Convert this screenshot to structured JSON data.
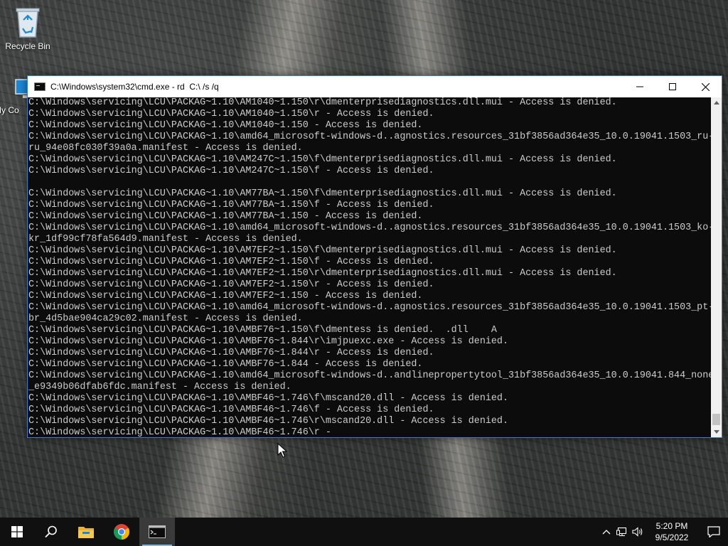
{
  "desktop": {
    "icons": [
      {
        "label": "Recycle Bin",
        "icon": "recycle-bin-icon"
      },
      {
        "label": "My Co",
        "icon": "computer-icon"
      }
    ]
  },
  "cmd_window": {
    "title": "C:\\Windows\\system32\\cmd.exe - rd  C:\\ /s /q",
    "controls": {
      "minimize": "minimize-icon",
      "maximize": "maximize-icon",
      "close": "close-icon"
    },
    "lines": [
      "C:\\Windows\\servicing\\LCU\\PACKAG~1.10\\AM1040~1.150\\r\\dmenterprisediagnostics.dll.mui - Access is denied.",
      "C:\\Windows\\servicing\\LCU\\PACKAG~1.10\\AM1040~1.150\\r - Access is denied.",
      "C:\\Windows\\servicing\\LCU\\PACKAG~1.10\\AM1040~1.150 - Access is denied.",
      "C:\\Windows\\servicing\\LCU\\PACKAG~1.10\\amd64_microsoft-windows-d..agnostics.resources_31bf3856ad364e35_10.0.19041.1503_ru-",
      "ru_94e08fc030f39a0a.manifest - Access is denied.",
      "C:\\Windows\\servicing\\LCU\\PACKAG~1.10\\AM247C~1.150\\f\\dmenterprisediagnostics.dll.mui - Access is denied.",
      "C:\\Windows\\servicing\\LCU\\PACKAG~1.10\\AM247C~1.150\\f - Access is denied.",
      "",
      "C:\\Windows\\servicing\\LCU\\PACKAG~1.10\\AM77BA~1.150\\f\\dmenterprisediagnostics.dll.mui - Access is denied.",
      "C:\\Windows\\servicing\\LCU\\PACKAG~1.10\\AM77BA~1.150\\f - Access is denied.",
      "C:\\Windows\\servicing\\LCU\\PACKAG~1.10\\AM77BA~1.150 - Access is denied.",
      "C:\\Windows\\servicing\\LCU\\PACKAG~1.10\\amd64_microsoft-windows-d..agnostics.resources_31bf3856ad364e35_10.0.19041.1503_ko-",
      "kr_1df99cf78fa564d9.manifest - Access is denied.",
      "C:\\Windows\\servicing\\LCU\\PACKAG~1.10\\AM7EF2~1.150\\f\\dmenterprisediagnostics.dll.mui - Access is denied.",
      "C:\\Windows\\servicing\\LCU\\PACKAG~1.10\\AM7EF2~1.150\\f - Access is denied.",
      "C:\\Windows\\servicing\\LCU\\PACKAG~1.10\\AM7EF2~1.150\\r\\dmenterprisediagnostics.dll.mui - Access is denied.",
      "C:\\Windows\\servicing\\LCU\\PACKAG~1.10\\AM7EF2~1.150\\r - Access is denied.",
      "C:\\Windows\\servicing\\LCU\\PACKAG~1.10\\AM7EF2~1.150 - Access is denied.",
      "C:\\Windows\\servicing\\LCU\\PACKAG~1.10\\amd64_microsoft-windows-d..agnostics.resources_31bf3856ad364e35_10.0.19041.1503_pt-",
      "br_4d5bae904ca29c02.manifest - Access is denied.",
      "C:\\Windows\\servicing\\LCU\\PACKAG~1.10\\AMBF76~1.150\\f\\dmentess is denied.  .dll    A",
      "C:\\Windows\\servicing\\LCU\\PACKAG~1.10\\AMBF76~1.844\\r\\imjpuexc.exe - Access is denied.",
      "C:\\Windows\\servicing\\LCU\\PACKAG~1.10\\AMBF76~1.844\\r - Access is denied.",
      "C:\\Windows\\servicing\\LCU\\PACKAG~1.10\\AMBF76~1.844 - Access is denied.",
      "C:\\Windows\\servicing\\LCU\\PACKAG~1.10\\amd64_microsoft-windows-d..andlinepropertytool_31bf3856ad364e35_10.0.19041.844_none",
      "_e9349b06dfab6fdc.manifest - Access is denied.",
      "C:\\Windows\\servicing\\LCU\\PACKAG~1.10\\AMBF46~1.746\\f\\mscand20.dll - Access is denied.",
      "C:\\Windows\\servicing\\LCU\\PACKAG~1.10\\AMBF46~1.746\\f - Access is denied.",
      "C:\\Windows\\servicing\\LCU\\PACKAG~1.10\\AMBF46~1.746\\r\\mscand20.dll - Access is denied.",
      "C:\\Windows\\servicing\\LCU\\PACKAG~1.10\\AMBF46~1.746\\r -"
    ]
  },
  "taskbar": {
    "buttons": [
      "windows-start-icon",
      "search-icon",
      "file-explorer-icon",
      "chrome-icon",
      "command-prompt-icon"
    ],
    "tray": [
      "chevron-up-icon",
      "network-icon",
      "volume-icon"
    ],
    "clock": {
      "time": "5:20 PM",
      "date": "9/5/2022"
    },
    "notifications": "action-center-icon"
  },
  "colors": {
    "console_bg": "#0c0c0c",
    "console_text": "#cccccc",
    "taskbar_bg": "#101010",
    "accent": "#76b9ed"
  }
}
